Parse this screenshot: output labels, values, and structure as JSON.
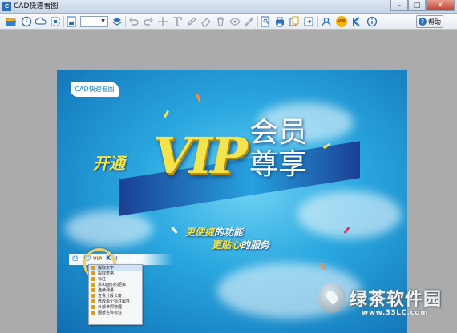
{
  "window": {
    "title": "CAD快速看图",
    "app_icon_letter": "C",
    "controls": {
      "minimize": "–",
      "maximize": "□",
      "close": "✕"
    }
  },
  "toolbar": {
    "help_label": "帮助",
    "help_icon": "?",
    "vip_badge": "VIP",
    "icons": [
      "folder-open-icon",
      "clock-icon",
      "cloud-icon",
      "fit-screen-icon",
      "image-icon",
      "layers-icon",
      "undo-icon",
      "redo-icon",
      "text-icon",
      "pencil-icon",
      "eraser-icon",
      "trash-icon",
      "eye-icon",
      "info-icon",
      "measure-icon",
      "print-icon",
      "copy-icon",
      "export-icon",
      "user-icon",
      "vip-icon",
      "k-icon",
      "about-icon"
    ]
  },
  "document": {
    "logo_text": "CAD快速看图",
    "kaitong": "开通",
    "vip": "VIP",
    "huiyuan_top": "会员",
    "huiyuan_bottom": "尊享",
    "sub1_a": "更便捷",
    "sub1_b": "的功能",
    "sub2_a": "更贴心",
    "sub2_b": "的服务"
  },
  "mini_toolbar": {
    "vip_label": "VIP",
    "k_label": "K",
    "info_label": "i"
  },
  "context_menu": {
    "items": [
      "提取文字",
      "提取表格",
      "标注",
      "求和面积的距离",
      "连续测量",
      "查看分段长度",
      "修改单个标注属性",
      "外部参照管理",
      "图纸名称标注"
    ]
  },
  "watermark": {
    "name": "绿茶软件园",
    "url": "www.33LC.com"
  },
  "colors": {
    "banner_blue": "#1a3f93",
    "vip_yellow": "#f4e34a",
    "sky_blue": "#2aa8e0"
  }
}
